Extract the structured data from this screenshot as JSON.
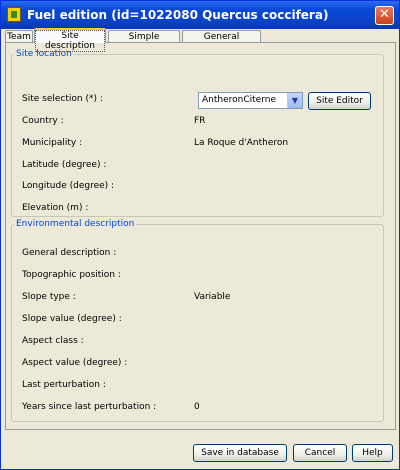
{
  "window": {
    "title": "Fuel edition  (id=1022080 Quercus coccifera)",
    "close_glyph": "✕"
  },
  "tabs": [
    {
      "label": "Team",
      "active": false
    },
    {
      "label": "Site description",
      "active": true
    },
    {
      "label": "Simple individual",
      "active": false
    },
    {
      "label": "General comments",
      "active": false
    }
  ],
  "site_location": {
    "legend": "Site location",
    "site_selection_label": "Site selection (*) :",
    "site_selection_value": "AntheronCiterne",
    "site_editor_button": "Site Editor",
    "rows": [
      {
        "label": "Country :",
        "value": "FR"
      },
      {
        "label": "Municipality :",
        "value": "La Roque d'Antheron"
      },
      {
        "label": "Latitude (degree) :",
        "value": ""
      },
      {
        "label": "Longitude (degree) :",
        "value": ""
      },
      {
        "label": "Elevation (m) :",
        "value": ""
      }
    ]
  },
  "environmental": {
    "legend": "Environmental description",
    "rows": [
      {
        "label": "General description :",
        "value": ""
      },
      {
        "label": "Topographic position :",
        "value": ""
      },
      {
        "label": "Slope type :",
        "value": "Variable"
      },
      {
        "label": "Slope value (degree) :",
        "value": ""
      },
      {
        "label": "Aspect class :",
        "value": ""
      },
      {
        "label": "Aspect value (degree)  :",
        "value": ""
      },
      {
        "label": "Last perturbation :",
        "value": ""
      },
      {
        "label": "Years since last perturbation :",
        "value": "0"
      }
    ]
  },
  "footer": {
    "save_button": "Save in database",
    "cancel_button": "Cancel",
    "help_button": "Help"
  },
  "colors": {
    "titlebar": "#0a49d6",
    "legend_text": "#0046d5",
    "window_bg": "#ece9d8"
  },
  "icons": {
    "app": "fuel-app-icon",
    "close": "close-icon",
    "combo": "chevron-down-icon"
  }
}
